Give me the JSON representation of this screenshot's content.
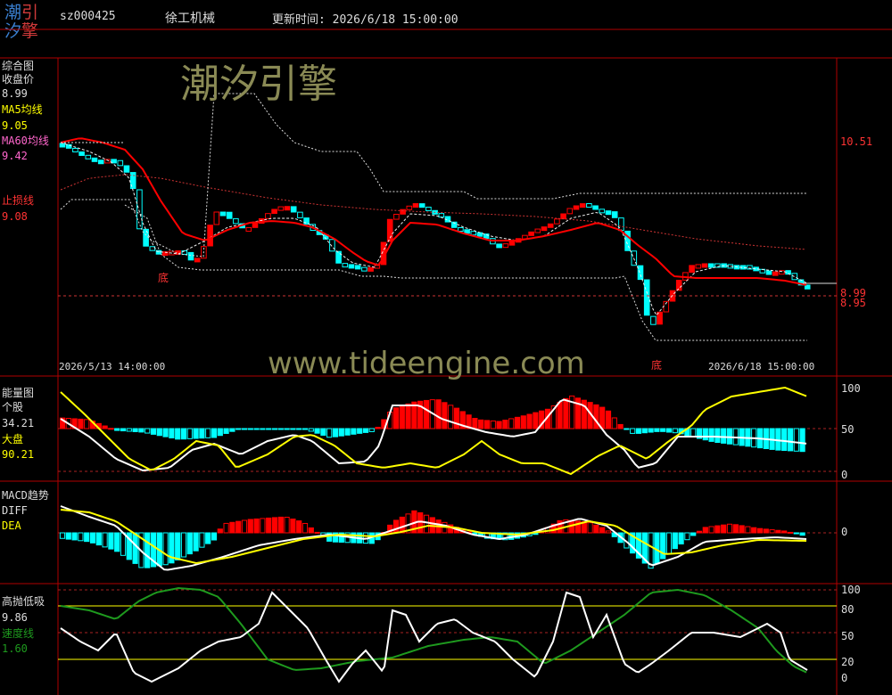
{
  "header": {
    "logo_chars": [
      "潮",
      "引",
      "汐",
      "擎"
    ],
    "code": "sz000425",
    "name": "徐工机械",
    "update_time": "更新时间: 2026/6/18 15:00:00"
  },
  "colors": {
    "up": "#ff0000",
    "down": "#00ffff",
    "ma5": "#ffffff",
    "ma60": "#ff0000",
    "yellow": "#ffff00",
    "green": "#1e9a1e",
    "grid": "#b00000"
  },
  "panels": {
    "main": {
      "title": "综合图",
      "close_label": "收盘价",
      "close_value": "8.99",
      "ma5_label": "MA5均线",
      "ma5_value": "9.05",
      "ma60_label": "MA60均线",
      "ma60_value": "9.42",
      "stop_label": "止损线",
      "stop_value": "9.08",
      "axis_labels": [
        "10.51",
        "8.99",
        "8.95"
      ],
      "date_start": "2026/5/13 14:00:00",
      "date_end": "2026/6/18 15:00:00",
      "bottom_marks": [
        "底",
        "底"
      ]
    },
    "energy": {
      "title": "能量图",
      "stock_label": "个股",
      "stock_value": "34.21",
      "market_label": "大盘",
      "market_value": "90.21",
      "axis_labels": [
        "100",
        "50",
        "0"
      ]
    },
    "macd": {
      "title": "MACD趋势",
      "diff_label": "DIFF",
      "dea_label": "DEA",
      "axis_labels": [
        "0"
      ]
    },
    "sweep": {
      "title": "高抛低吸",
      "value": "9.86",
      "speed_label": "速度线",
      "speed_value": "1.60",
      "axis_labels": [
        "100",
        "80",
        "50",
        "20",
        "0"
      ]
    }
  },
  "watermarks": {
    "main": "潮汐引擎",
    "url": "www.tideengine.com"
  }
}
